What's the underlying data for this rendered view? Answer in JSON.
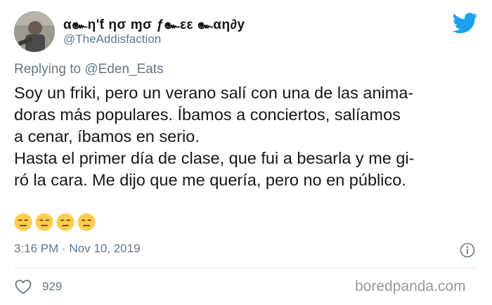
{
  "tweet": {
    "display_name": "α๛η'ƭ ησ ɱσ ƒ๛εε ๛αη∂у",
    "handle": "@TheAddisfaction",
    "reply_prefix": "Replying to",
    "reply_mention": "@Eden_Eats",
    "body_lines": [
      "Soy un friki, pero un verano salí con una de las anima-",
      "doras más populares. Íbamos a conciertos, salíamos",
      "a cenar, íbamos en serio.",
      "Hasta el primer día de clase, que fui a besarla y me gi-",
      "ró la cara. Me dijo que me quería, pero no en público."
    ],
    "emojis": [
      "expressionless-face",
      "expressionless-face",
      "expressionless-face",
      "expressionless-face"
    ],
    "timestamp": "3:16 PM · Nov 10, 2019",
    "like_count": "929"
  },
  "icons": {
    "brand": "twitter-bird",
    "info": "info-circle",
    "like": "heart-outline"
  },
  "watermark": "boredpanda.com",
  "colors": {
    "twitter_blue": "#1da1f2",
    "secondary_text": "#657786",
    "primary_text": "#14171a",
    "emoji_yellow": "#ffcc4d",
    "divider": "#e1e8ed"
  }
}
